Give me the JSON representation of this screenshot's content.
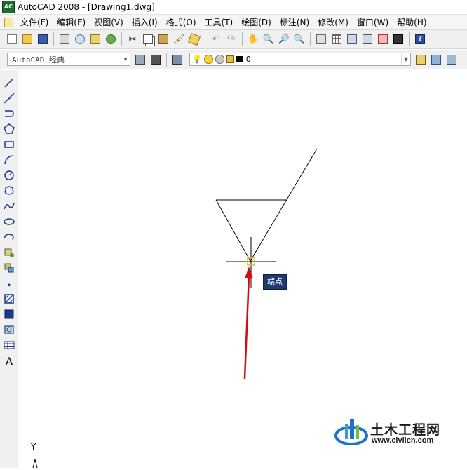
{
  "window": {
    "title": "AutoCAD 2008 - [Drawing1.dwg]",
    "app_icon_text": "AC"
  },
  "menubar": {
    "items": [
      "文件(F)",
      "编辑(E)",
      "视图(V)",
      "插入(I)",
      "格式(O)",
      "工具(T)",
      "绘图(D)",
      "标注(N)",
      "修改(M)",
      "窗口(W)",
      "帮助(H)"
    ]
  },
  "toolbar_standard": {
    "icons": [
      "new-icon",
      "open-icon",
      "save-icon",
      "plot-icon",
      "plot-preview-icon",
      "publish-icon",
      "3d-dwf-icon",
      "cut-icon",
      "copy-icon",
      "paste-icon",
      "match-properties-icon",
      "block-editor-icon",
      "undo-icon",
      "redo-icon",
      "pan-icon",
      "zoom-realtime-icon",
      "zoom-window-icon",
      "zoom-previous-icon",
      "properties-icon",
      "design-center-icon",
      "tool-palettes-icon",
      "sheet-set-icon",
      "markup-icon",
      "quickcalc-icon",
      "help-icon"
    ]
  },
  "workspace": {
    "value": "AutoCAD 经典"
  },
  "layer": {
    "value": "0"
  },
  "draw_toolbar": {
    "icons": [
      "line-icon",
      "construction-line-icon",
      "polyline-icon",
      "polygon-icon",
      "rectangle-icon",
      "arc-icon",
      "circle-icon",
      "revision-cloud-icon",
      "spline-icon",
      "ellipse-icon",
      "ellipse-arc-icon",
      "insert-block-icon",
      "make-block-icon",
      "point-icon",
      "hatch-icon",
      "gradient-icon",
      "region-icon",
      "table-icon",
      "multiline-text-icon"
    ],
    "text_label": "A"
  },
  "drawing": {
    "osnap_tooltip": "端点"
  },
  "ucs": {
    "y_label": "Y"
  },
  "watermark": {
    "title": "土木工程网",
    "url": "www.civilcn.com"
  },
  "colors": {
    "tooltip_bg": "#1e3a6e",
    "arrow": "#d10c0c",
    "aperture": "#d9c23c"
  }
}
